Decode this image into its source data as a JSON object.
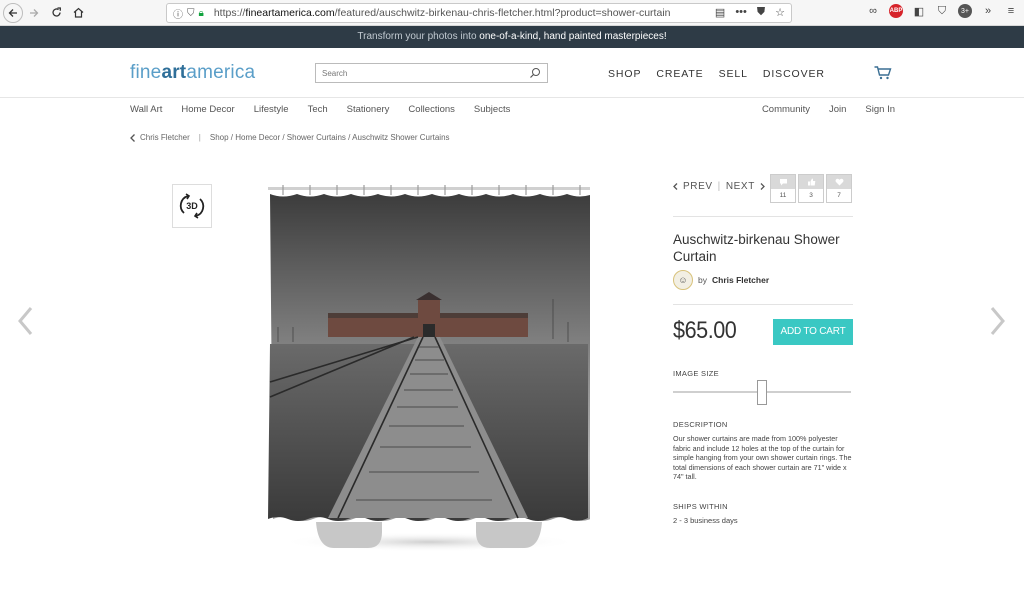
{
  "browser": {
    "url_prefix": "https://",
    "url_domain": "fineartamerica.com",
    "url_path": "/featured/auschwitz-birkenau-chris-fletcher.html?product=shower-curtain",
    "abp_label": "ABP",
    "ext_badge": "3+"
  },
  "promo": {
    "text": "Transform your photos into ",
    "highlight": "one-of-a-kind, hand painted masterpieces!"
  },
  "header": {
    "logo_fine": "fine",
    "logo_art": "art",
    "logo_america": "america",
    "search_placeholder": "Search",
    "nav": [
      "SHOP",
      "CREATE",
      "SELL",
      "DISCOVER"
    ]
  },
  "subnav": {
    "left": [
      "Wall Art",
      "Home Decor",
      "Lifestyle",
      "Tech",
      "Stationery",
      "Collections",
      "Subjects"
    ],
    "right": [
      "Community",
      "Join",
      "Sign In"
    ]
  },
  "breadcrumb": {
    "artist": "Chris Fletcher",
    "sep": "|",
    "path": "Shop / Home Decor / Shower Curtains / Auschwitz Shower Curtains"
  },
  "product": {
    "btn_3d": "3D",
    "prev": "PREV",
    "next": "NEXT",
    "divider": "|",
    "stats": {
      "comments": "11",
      "likes": "3",
      "favorites": "7"
    },
    "title": "Auschwitz-birkenau Shower Curtain",
    "by": "by",
    "artist": "Chris Fletcher",
    "price": "$65.00",
    "add_to_cart": "ADD TO CART",
    "image_size_label": "IMAGE SIZE",
    "image_size_slider": 0.5,
    "description_label": "DESCRIPTION",
    "description": "Our shower curtains are made from 100% polyester fabric and include 12 holes at the top of the curtain for simple hanging from your own shower curtain rings. The total dimensions of each shower curtain are 71\" wide x 74\" tall.",
    "ships_label": "SHIPS WITHIN",
    "ships_value": "2 - 3 business days"
  },
  "colors": {
    "promo_bg": "#2e3b46",
    "logo": "#5a9ec8",
    "cart_button": "#3ac8c3"
  }
}
